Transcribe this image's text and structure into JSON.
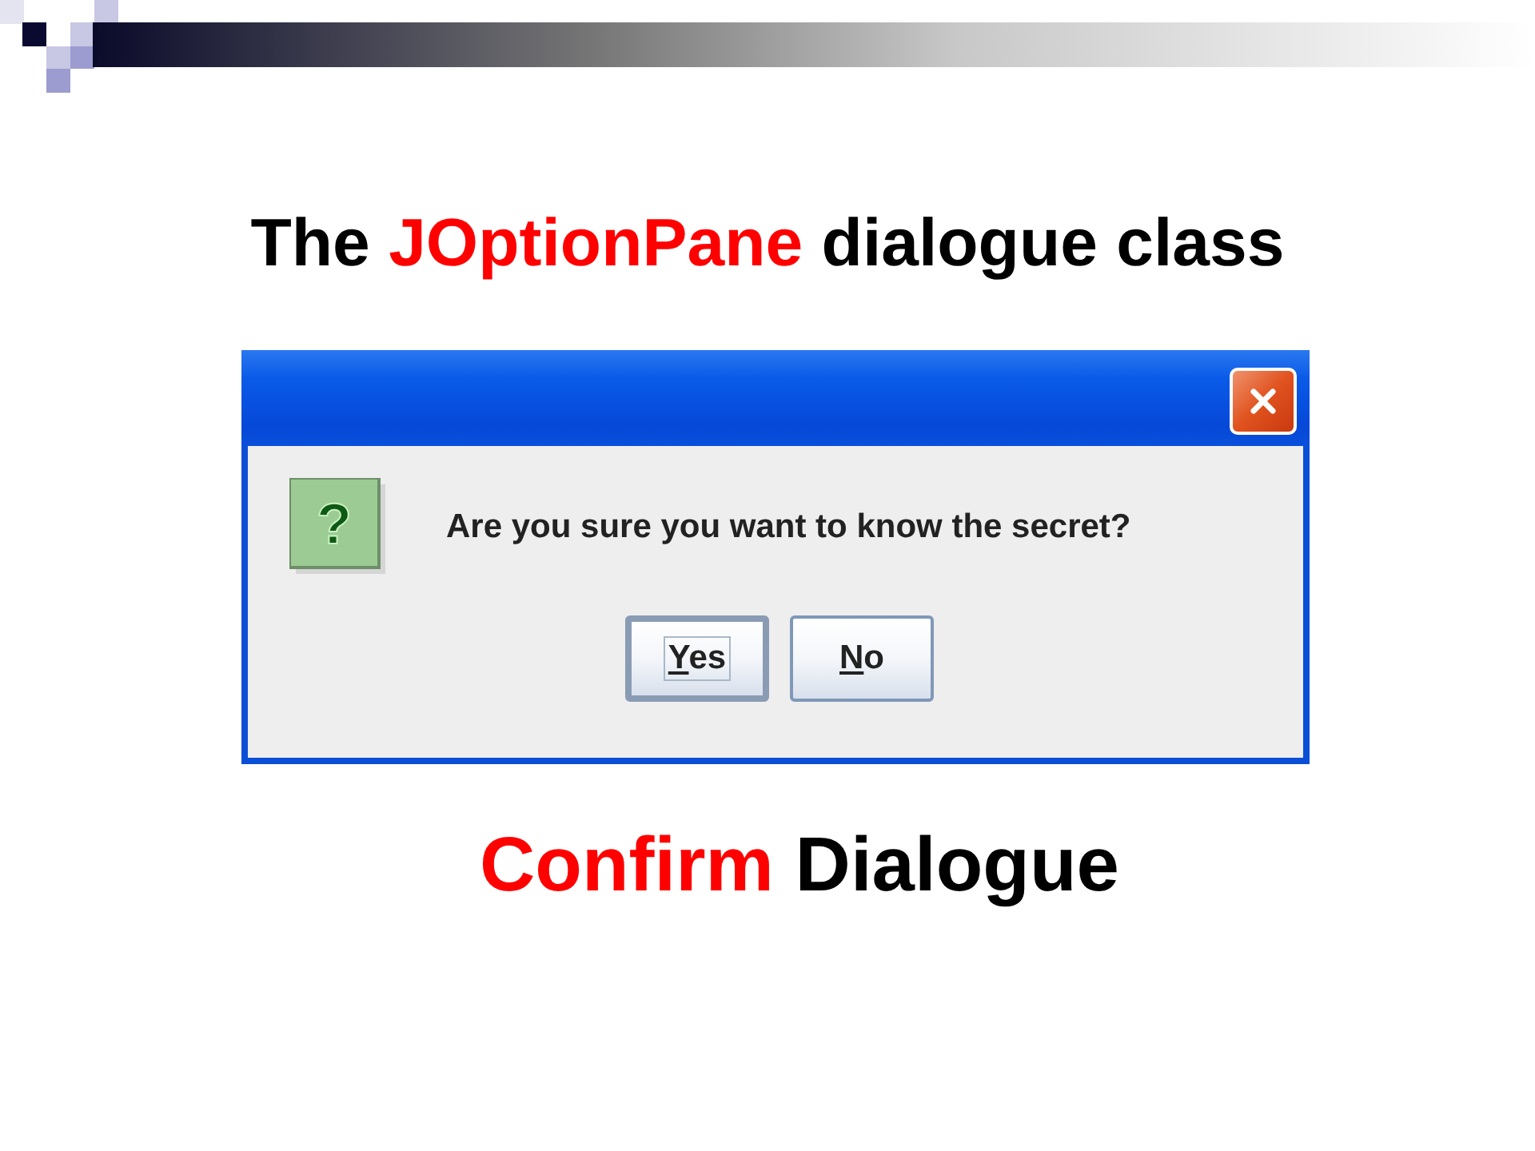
{
  "heading": [
    {
      "text": "The ",
      "accent": false
    },
    {
      "text": "JOptionPane",
      "accent": true
    },
    {
      "text": " dialogue class",
      "accent": false
    }
  ],
  "dialog": {
    "icon_glyph": "?",
    "message": "Are you sure you want to know the secret?",
    "buttons": [
      {
        "label": "Yes",
        "focused": true,
        "mnemonic_underlined": true
      },
      {
        "label": "No",
        "focused": false,
        "mnemonic_underlined": true
      }
    ]
  },
  "caption": [
    {
      "text": "Confirm",
      "accent": true
    },
    {
      "text": " Dialogue",
      "accent": false
    }
  ]
}
